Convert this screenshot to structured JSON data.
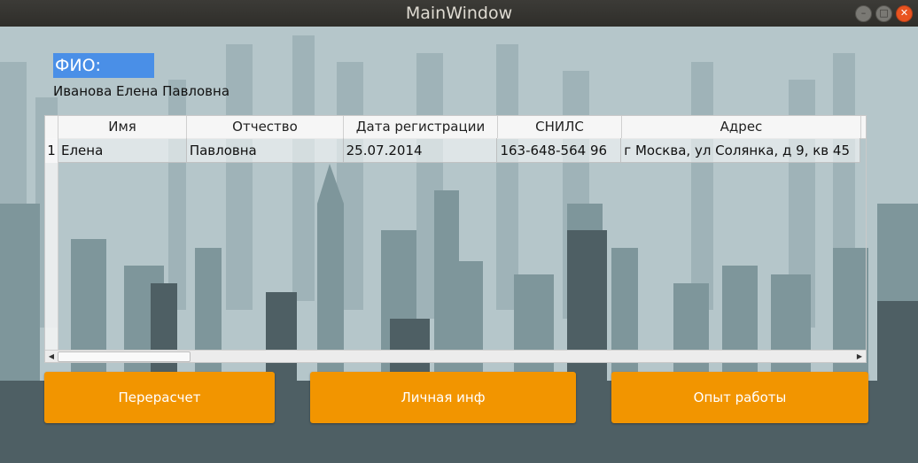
{
  "window": {
    "title": "MainWindow"
  },
  "fio": {
    "label": "ФИО:",
    "value": "Иванова Елена Павловна"
  },
  "table": {
    "columns": [
      "Имя",
      "Отчество",
      "Дата регистрации",
      "СНИЛС",
      "Адрес"
    ],
    "rows": [
      {
        "num": "1",
        "cells": [
          "Елена",
          "Павловна",
          "25.07.2014",
          "163-648-564 96",
          "г Москва, ул Солянка, д 9, кв 45"
        ]
      }
    ]
  },
  "buttons": {
    "recalc": "Перерасчет",
    "personal": "Личная инф",
    "experience": "Опыт работы"
  },
  "colors": {
    "accent_button": "#f29500",
    "selection": "#4a8fe7"
  }
}
